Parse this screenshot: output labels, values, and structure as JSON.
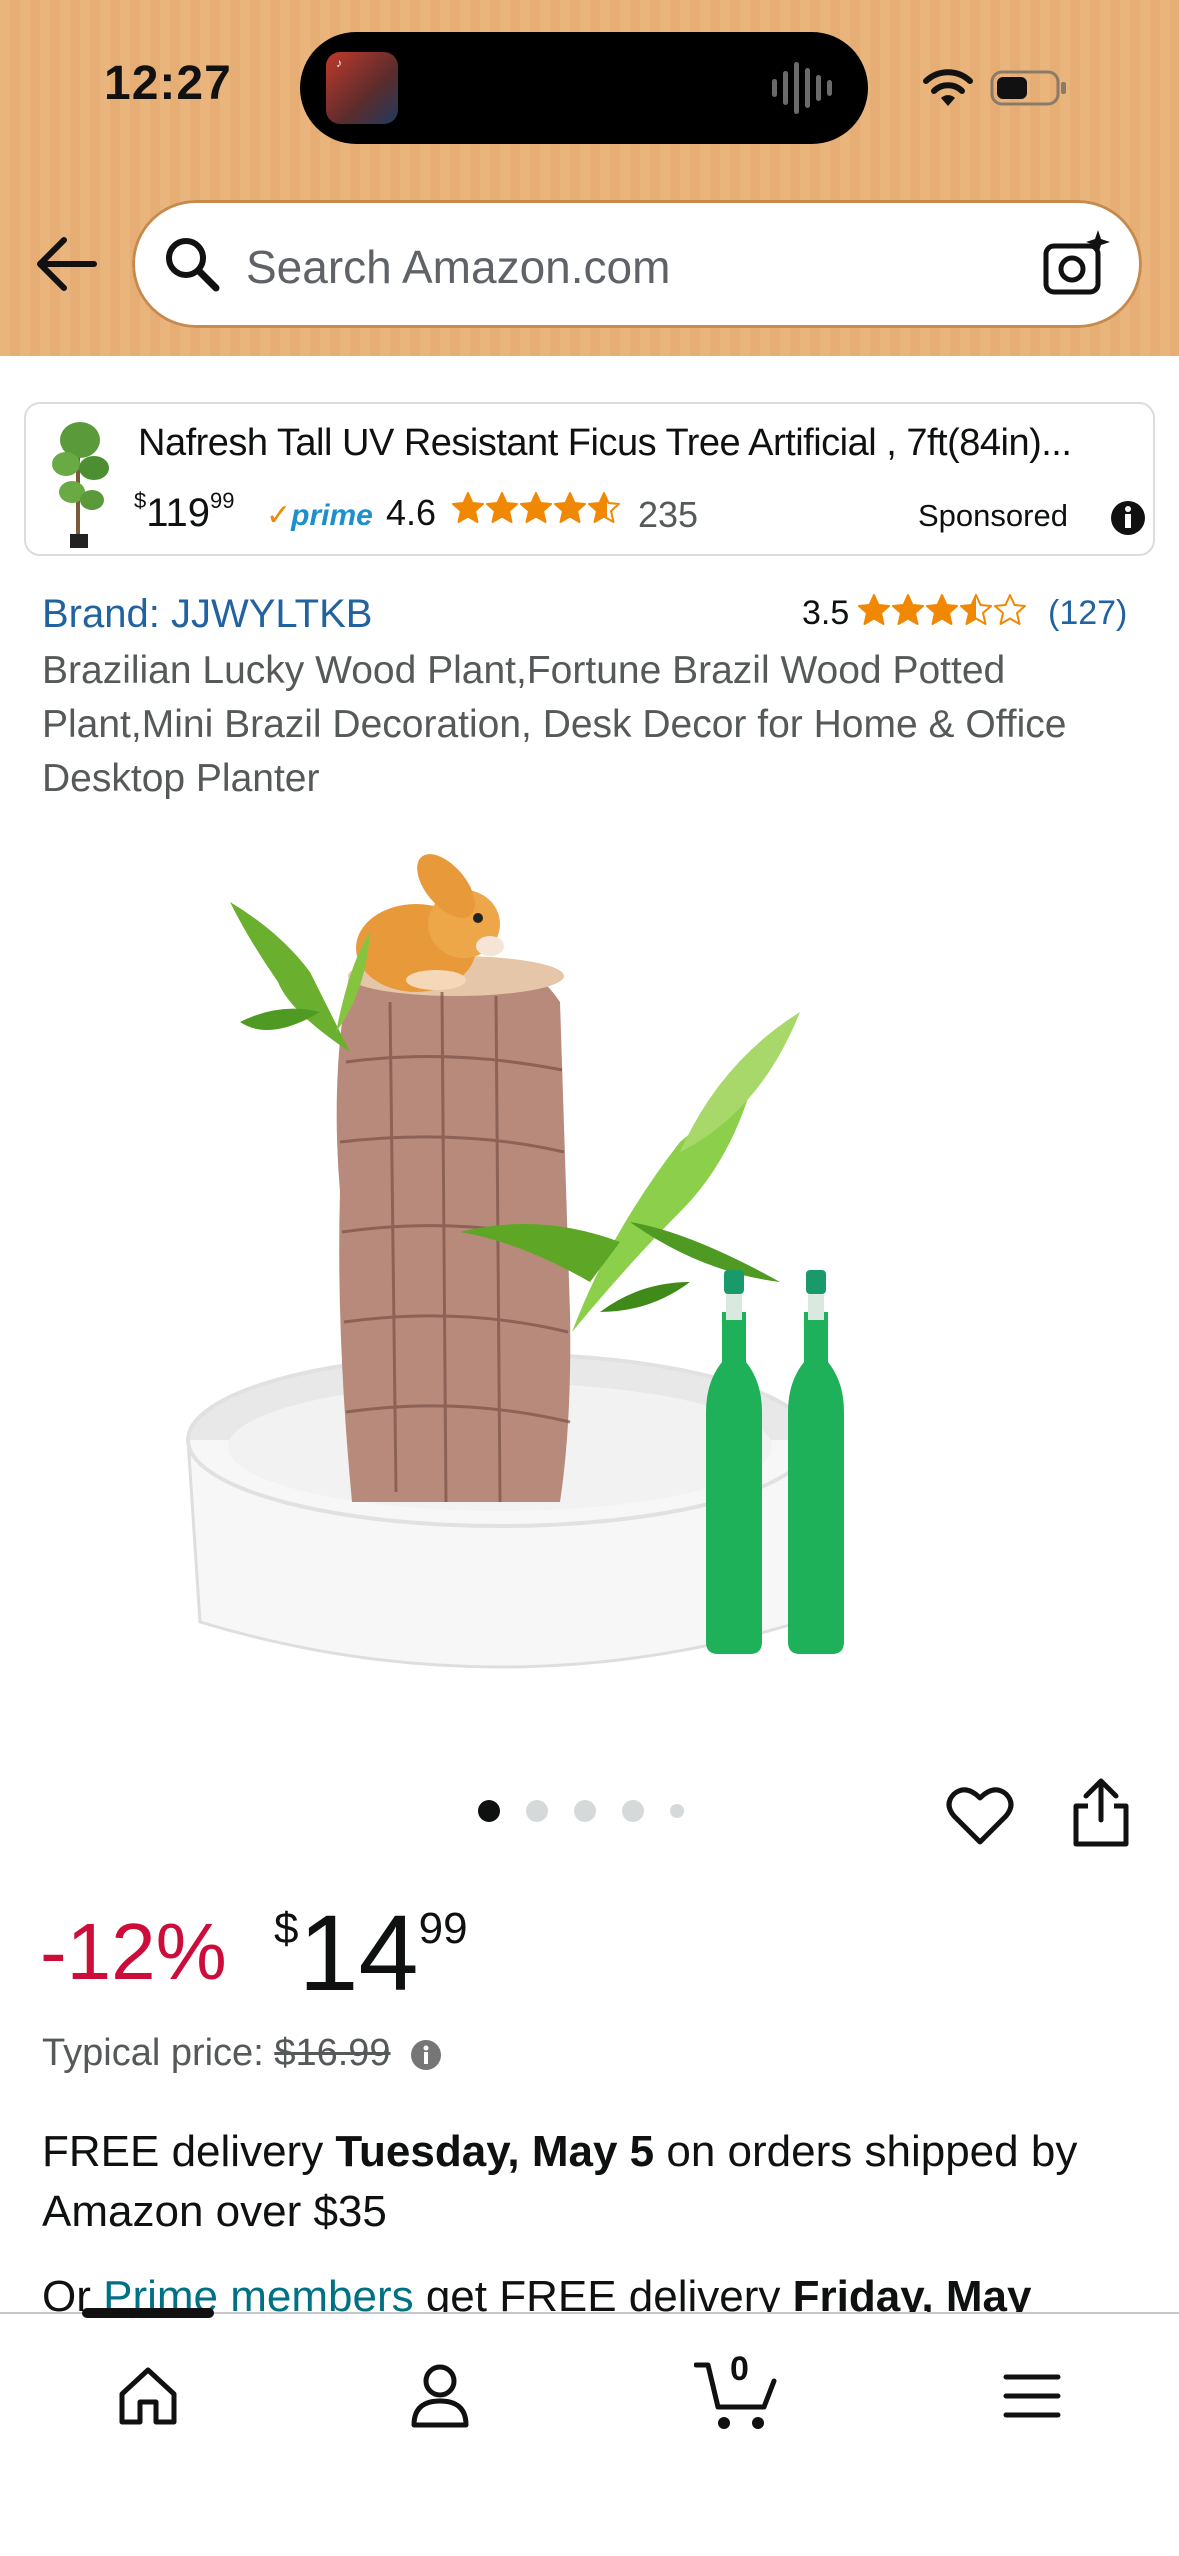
{
  "status_bar": {
    "time": "12:27"
  },
  "header": {
    "search_placeholder": "Search Amazon.com"
  },
  "sponsored": {
    "title": "Nafresh Tall UV Resistant Ficus Tree Artificial ,   7ft(84in)...",
    "price_currency": "$",
    "price_whole": "119",
    "price_fraction": "99",
    "prime_label": "prime",
    "rating": "4.6",
    "rating_value": 4.6,
    "review_count": "235",
    "label": "Sponsored"
  },
  "product": {
    "brand": "Brand: JJWYLTKB",
    "rating": "3.5",
    "rating_value": 3.5,
    "review_count": "(127)",
    "title": "Brazilian Lucky Wood Plant,Fortune Brazil Wood Potted Plant,Mini Brazil Decoration, Desk Decor for Home & Office Desktop Planter",
    "image_count": 5,
    "active_image": 1
  },
  "pricing": {
    "discount": "-12%",
    "currency": "$",
    "whole": "14",
    "fraction": "99",
    "typical_label": "Typical price:",
    "typical_price": "$16.99"
  },
  "delivery": {
    "prefix": "FREE delivery ",
    "date": "Tuesday, May 5",
    "suffix": " on orders shipped by Amazon over $35"
  },
  "prime_delivery": {
    "prefix": "Or ",
    "link": "Prime members",
    "middle": " get FREE delivery ",
    "date": "Friday, May"
  },
  "bottom_nav": {
    "cart_count": "0"
  },
  "colors": {
    "header_bg": "#eab57d",
    "discount": "#cc0c39",
    "link": "#2162a1",
    "star": "#f08804"
  }
}
